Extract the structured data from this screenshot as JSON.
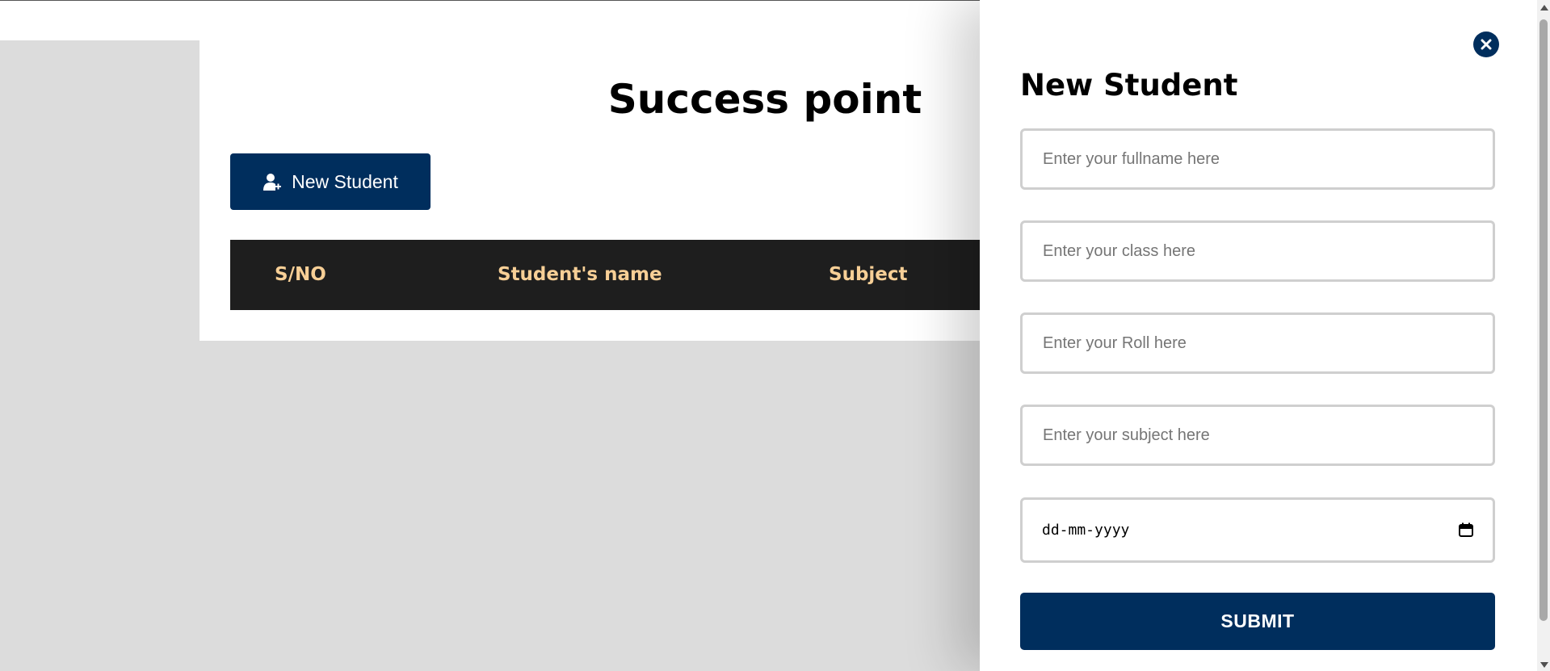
{
  "page": {
    "title": "Success point",
    "new_student_button": {
      "label": "New Student",
      "icon": "user-plus-icon"
    }
  },
  "table": {
    "headers": [
      "S/NO",
      "Student's name",
      "Subject"
    ]
  },
  "drawer": {
    "title": "New Student",
    "close_icon": "close-icon",
    "fields": {
      "fullname": {
        "placeholder": "Enter your fullname here",
        "value": ""
      },
      "class": {
        "placeholder": "Enter your class here",
        "value": ""
      },
      "roll": {
        "placeholder": "Enter your Roll here",
        "value": ""
      },
      "subject": {
        "placeholder": "Enter your subject here",
        "value": ""
      },
      "date": {
        "placeholder": "dd-mm-yyyy",
        "icon": "calendar-icon"
      }
    },
    "submit_label": "SUBMIT"
  },
  "colors": {
    "primary": "#002e5d",
    "table_header_bg": "#1e1e1e",
    "table_header_text": "#f7cf96",
    "background": "#dcdcdc"
  }
}
